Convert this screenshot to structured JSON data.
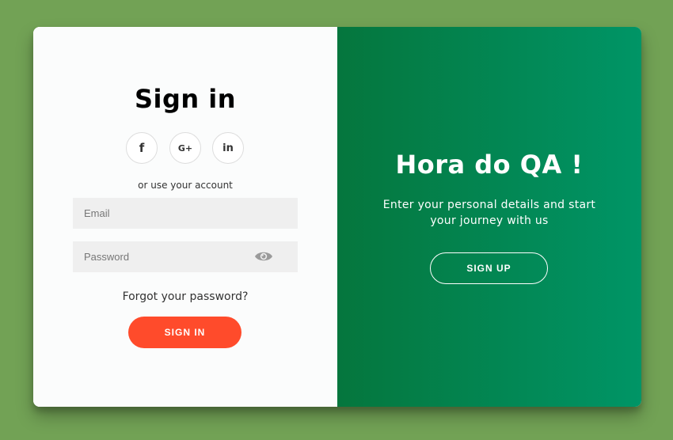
{
  "signin": {
    "title": "Sign in",
    "social": [
      {
        "icon": "facebook-icon",
        "glyph": "f"
      },
      {
        "icon": "google-plus-icon",
        "glyph": "G+"
      },
      {
        "icon": "linkedin-icon",
        "glyph": "in"
      }
    ],
    "or_text": "or use your account",
    "email_placeholder": "Email",
    "email_value": "",
    "password_placeholder": "Password",
    "password_value": "",
    "forgot": "Forgot your password?",
    "button": "SIGN IN"
  },
  "overlay": {
    "title": "Hora do QA !",
    "text": "Enter your personal details and start your journey with us",
    "button": "SIGN UP"
  },
  "colors": {
    "background": "#72a255",
    "primary_button": "#ff4b2b",
    "gradient_start": "#05763d",
    "gradient_end": "#009566"
  }
}
